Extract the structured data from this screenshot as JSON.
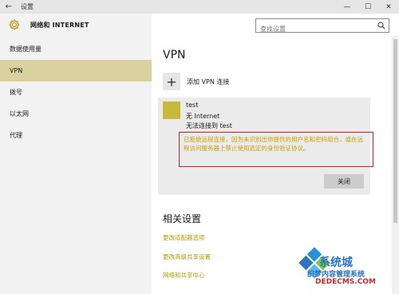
{
  "window": {
    "title": "设置",
    "back_glyph": "←",
    "minimize_glyph": "—",
    "maximize_glyph": "☐",
    "close_glyph": "✕"
  },
  "header": {
    "app_title": "网络和 INTERNET",
    "icon": "gear-icon",
    "search_placeholder": "查找设置",
    "search_icon": "search-icon"
  },
  "sidebar": {
    "items": [
      {
        "label": "数据使用量",
        "active": false
      },
      {
        "label": "VPN",
        "active": true
      },
      {
        "label": "拨号",
        "active": false
      },
      {
        "label": "以太网",
        "active": false
      },
      {
        "label": "代理",
        "active": false
      }
    ]
  },
  "main": {
    "title": "VPN",
    "add_vpn_label": "添加 VPN 连接",
    "add_vpn_glyph": "+",
    "vpn_entry": {
      "name": "test",
      "status1": "无 Internet",
      "status2": "无法连接到 test",
      "error_message": "已拒绝远程连接，因为未识别出你提供的用户名和密码组合，或在远程访问服务器上禁止使用选定的身份验证协议。",
      "close_label": "关闭"
    },
    "related_title": "相关设置",
    "related_links": [
      "更改适配器选项",
      "更改高级共享设置",
      "网络和共享中心"
    ]
  },
  "watermark": {
    "line1": "系统城",
    "line2": "织梦内容管理系统",
    "line3": "DEDECMS.COM"
  },
  "colors": {
    "accent": "#d9d2a0",
    "vpn_tile": "#c8b93a",
    "error_border": "#d41e1e",
    "link": "#b79a00"
  }
}
